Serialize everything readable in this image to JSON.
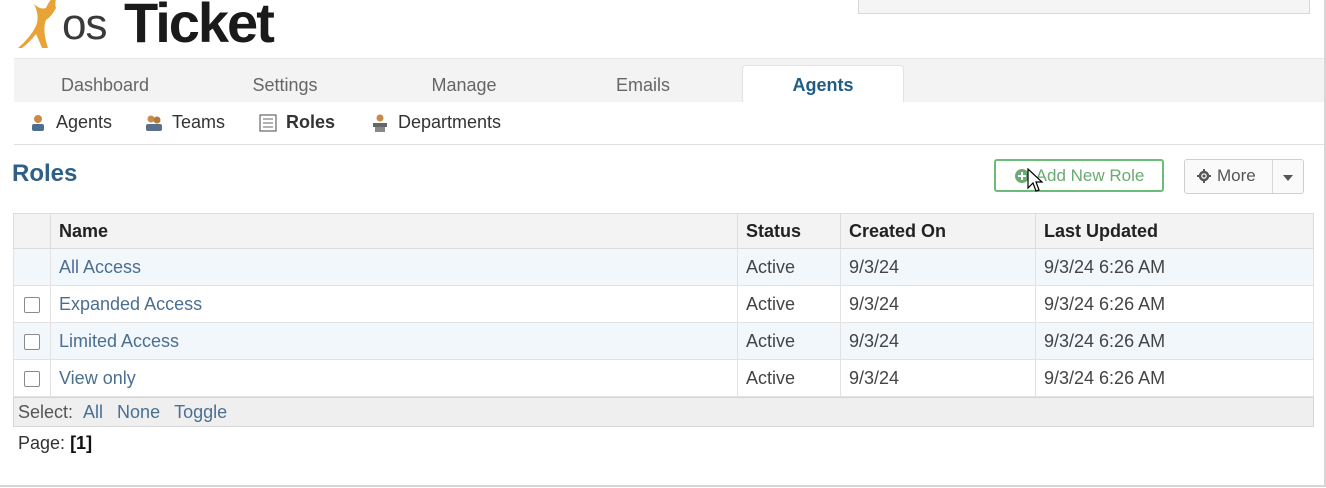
{
  "app": {
    "logo_os": "os",
    "logo_ticket": "Ticket"
  },
  "tabs": [
    {
      "label": "Dashboard"
    },
    {
      "label": "Settings"
    },
    {
      "label": "Manage"
    },
    {
      "label": "Emails"
    },
    {
      "label": "Agents",
      "active": true
    }
  ],
  "subnav": [
    {
      "label": "Agents",
      "icon": "agent-icon"
    },
    {
      "label": "Teams",
      "icon": "teams-icon"
    },
    {
      "label": "Roles",
      "icon": "roles-icon",
      "active": true
    },
    {
      "label": "Departments",
      "icon": "department-icon"
    }
  ],
  "page": {
    "title": "Roles",
    "add_button": "Add New Role",
    "more_button": "More"
  },
  "table": {
    "columns": [
      "Name",
      "Status",
      "Created On",
      "Last Updated"
    ],
    "rows": [
      {
        "name": "All Access",
        "status": "Active",
        "created": "9/3/24",
        "updated": "9/3/24 6:26 AM",
        "checkbox": false
      },
      {
        "name": "Expanded Access",
        "status": "Active",
        "created": "9/3/24",
        "updated": "9/3/24 6:26 AM",
        "checkbox": true
      },
      {
        "name": "Limited Access",
        "status": "Active",
        "created": "9/3/24",
        "updated": "9/3/24 6:26 AM",
        "checkbox": true
      },
      {
        "name": "View only",
        "status": "Active",
        "created": "9/3/24",
        "updated": "9/3/24 6:26 AM",
        "checkbox": true
      }
    ]
  },
  "select": {
    "label": "Select:",
    "all": "All",
    "none": "None",
    "toggle": "Toggle"
  },
  "pager": {
    "label": "Page:",
    "current": "[1]"
  },
  "colors": {
    "accent": "#2f5f86",
    "add_button_border": "#6cbb78",
    "link": "#4a6f91",
    "logo_orange": "#e8a236"
  }
}
